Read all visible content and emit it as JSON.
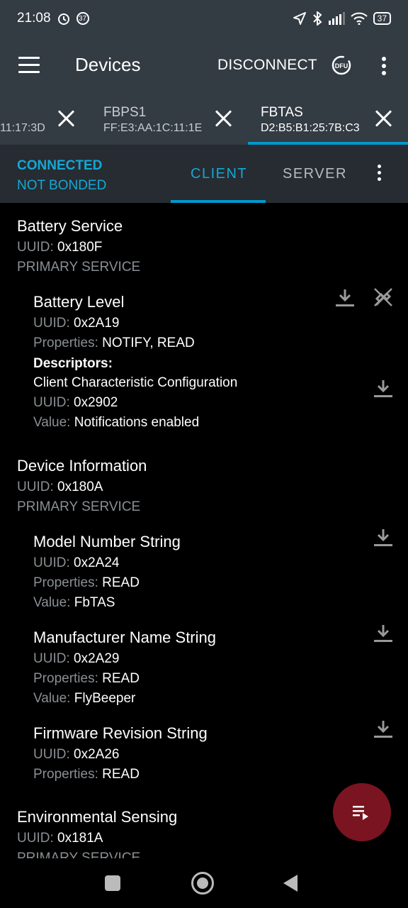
{
  "status_bar": {
    "time": "21:08",
    "notification_badge": "37",
    "battery": "37",
    "icons": [
      "alarm-icon",
      "location-icon",
      "bluetooth-icon",
      "signal-icon",
      "wifi-icon",
      "battery-icon"
    ]
  },
  "app_bar": {
    "title": "Devices",
    "disconnect_label": "DISCONNECT",
    "dfu_label": "DFU"
  },
  "device_tabs": [
    {
      "name": "",
      "address": "11:17:3D",
      "active": false
    },
    {
      "name": "FBPS1",
      "address": "FF:E3:AA:1C:11:1E",
      "active": false
    },
    {
      "name": "FBTAS",
      "address": "D2:B5:B1:25:7B:C3",
      "active": true
    }
  ],
  "connection": {
    "state": "CONNECTED",
    "bond": "NOT BONDED"
  },
  "mode_tabs": {
    "client": "CLIENT",
    "server": "SERVER",
    "active": "CLIENT"
  },
  "labels": {
    "uuid": "UUID:",
    "properties": "Properties:",
    "value": "Value:",
    "descriptors": "Descriptors:"
  },
  "services": [
    {
      "name": "Battery Service",
      "uuid": "0x180F",
      "type": "PRIMARY SERVICE",
      "characteristics": [
        {
          "name": "Battery Level",
          "uuid": "0x2A19",
          "properties": "NOTIFY, READ",
          "descriptor": {
            "name": "Client Characteristic Configuration",
            "uuid": "0x2902",
            "value": "Notifications enabled"
          }
        }
      ]
    },
    {
      "name": "Device Information",
      "uuid": "0x180A",
      "type": "PRIMARY SERVICE",
      "characteristics": [
        {
          "name": "Model Number String",
          "uuid": "0x2A24",
          "properties": "READ",
          "value": "FbTAS"
        },
        {
          "name": "Manufacturer Name String",
          "uuid": "0x2A29",
          "properties": "READ",
          "value": "FlyBeeper"
        },
        {
          "name": "Firmware Revision String",
          "uuid": "0x2A26",
          "properties": "READ"
        }
      ]
    },
    {
      "name": "Environmental Sensing",
      "uuid": "0x181A",
      "type": "PRIMARY SERVICE"
    }
  ],
  "colors": {
    "accent": "#15a7d6",
    "toolbar": "#333b43",
    "fab": "#7a1420"
  }
}
